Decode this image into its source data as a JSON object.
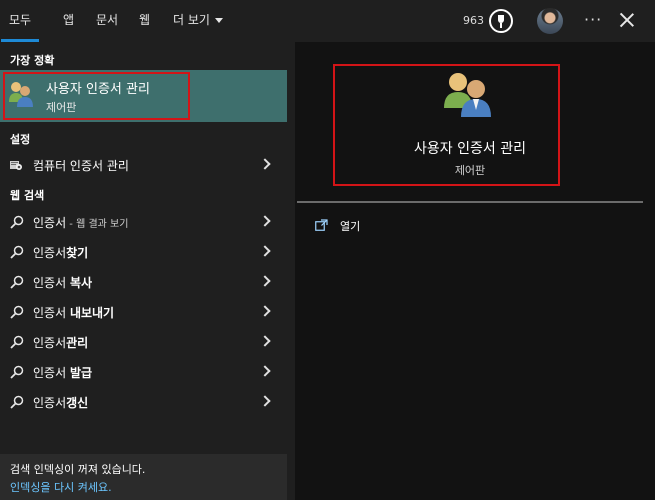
{
  "tabs": [
    {
      "label": "모두"
    },
    {
      "label": "앱"
    },
    {
      "label": "문서"
    },
    {
      "label": "웹"
    },
    {
      "label": "더 보기"
    }
  ],
  "header": {
    "points": "963",
    "trophy_icon": "trophy-icon",
    "avatar_icon": "user-avatar",
    "more_label": "···",
    "close_icon": "close-icon"
  },
  "left": {
    "best_match": {
      "section_title": "가장 정확",
      "title": "사용자 인증서 관리",
      "subtitle": "제어판",
      "icon": "users-icon"
    },
    "settings": {
      "section_title": "설정",
      "items": [
        {
          "label": "컴퓨터 인증서 관리",
          "icon": "certificate-settings-icon"
        }
      ]
    },
    "web": {
      "section_title": "웹 검색",
      "items": [
        {
          "pre": "인증서",
          "bold": "",
          "suffix": " - 웹 결과 보기"
        },
        {
          "pre": "인증서",
          "bold": "찾기",
          "suffix": ""
        },
        {
          "pre": "인증서 ",
          "bold": "복사",
          "suffix": ""
        },
        {
          "pre": "인증서 ",
          "bold": "내보내기",
          "suffix": ""
        },
        {
          "pre": "인증서",
          "bold": "관리",
          "suffix": ""
        },
        {
          "pre": "인증서 ",
          "bold": "발급",
          "suffix": ""
        },
        {
          "pre": "인증서",
          "bold": "갱신",
          "suffix": ""
        }
      ]
    },
    "footer": {
      "text": "검색 인덱싱이 꺼져 있습니다.",
      "link": "인덱싱을 다시 켜세요."
    }
  },
  "right": {
    "title": "사용자 인증서 관리",
    "subtitle": "제어판",
    "actions": [
      {
        "label": "열기",
        "icon": "open-icon"
      }
    ]
  },
  "colors": {
    "accent": "#1e8ad6",
    "selected_bg": "#3e6f6d",
    "highlight_box": "#d31417",
    "link": "#6cc6ff"
  }
}
